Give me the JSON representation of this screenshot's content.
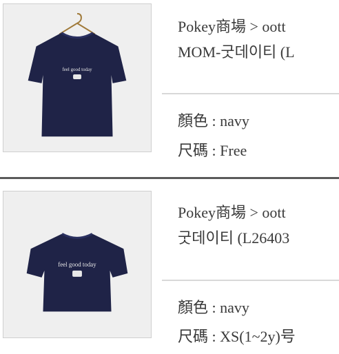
{
  "items": [
    {
      "breadcrumb": "Pokey商場 > oott",
      "product_name": "MOM-굿데이티 (L",
      "color_label": "顏色",
      "color_value": ": navy",
      "size_label": "尺碼",
      "size_value": ": Free",
      "shirt_print": "feel good today"
    },
    {
      "breadcrumb": "Pokey商場 > oott",
      "product_name": "굿데이티 (L26403",
      "color_label": "顏色",
      "color_value": ": navy",
      "size_label": "尺碼",
      "size_value": ": XS(1~2y)号",
      "shirt_print": "feel good today"
    }
  ],
  "colors": {
    "shirt": "#1f2347",
    "background": "#efefef",
    "separator": "#5a5a5a"
  }
}
